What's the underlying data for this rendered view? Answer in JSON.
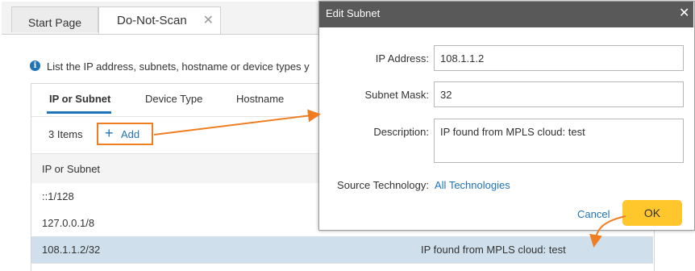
{
  "tabs": [
    {
      "label": "Start Page"
    },
    {
      "label": "Do-Not-Scan",
      "active": true
    }
  ],
  "info": {
    "text": "List the IP address, subnets, hostname or device types y"
  },
  "subtabs": [
    {
      "label": "IP or Subnet",
      "active": true
    },
    {
      "label": "Device Type"
    },
    {
      "label": "Hostname"
    }
  ],
  "toolbar": {
    "items_count": "3 Items",
    "add_label": "Add"
  },
  "table": {
    "columns": [
      "IP or Subnet"
    ],
    "rows": [
      {
        "ip": "::1/128",
        "description": ""
      },
      {
        "ip": "127.0.0.1/8",
        "description": ""
      },
      {
        "ip": "108.1.1.2/32",
        "description": "IP found from MPLS cloud: test",
        "selected": true
      }
    ]
  },
  "dialog": {
    "title": "Edit Subnet",
    "ip_label": "IP Address:",
    "ip_value": "108.1.1.2",
    "mask_label": "Subnet Mask:",
    "mask_value": "32",
    "desc_label": "Description:",
    "desc_value": "IP found from MPLS cloud: test",
    "source_label": "Source Technology:",
    "source_value": "All Technologies",
    "cancel_label": "Cancel",
    "ok_label": "OK"
  },
  "colors": {
    "accent": "#1f73b7",
    "highlight": "#ef7d22",
    "ok_button": "#ffc72c",
    "selected_row": "#cfe0ec",
    "dialog_header": "#595959"
  },
  "icons": {
    "info": "info-icon",
    "add": "plus-icon",
    "close": "close-icon"
  }
}
